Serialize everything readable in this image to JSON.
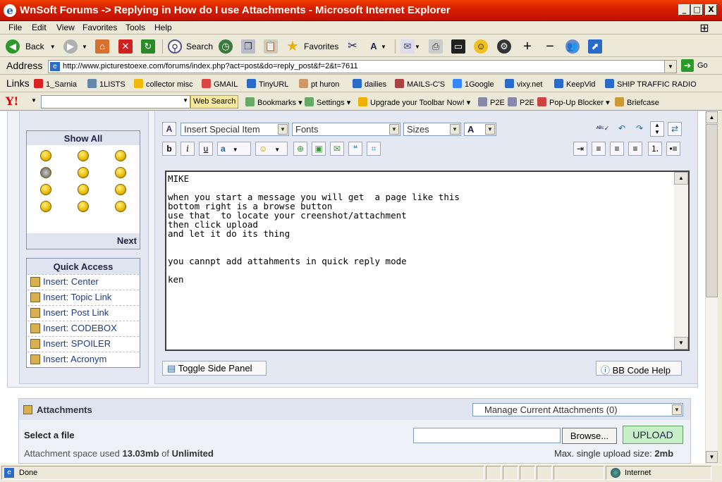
{
  "window": {
    "title": "WnSoft Forums -> Replying in How do I use Attachments - Microsoft Internet Explorer",
    "min": "_",
    "max": "□",
    "close": "X"
  },
  "menu": [
    "File",
    "Edit",
    "View",
    "Favorites",
    "Tools",
    "Help"
  ],
  "toolbar": {
    "back": "Back",
    "search": "Search",
    "favorites": "Favorites"
  },
  "address": {
    "label": "Address",
    "url": "http://www.picturestoexe.com/forums/index.php?act=post&do=reply_post&f=2&t=7611",
    "go": "Go"
  },
  "links": {
    "label": "Links",
    "items": [
      "1_Sarnia",
      "1LISTS",
      "collector misc",
      "GMAIL",
      "TinyURL",
      "pt huron",
      "dailies",
      "MAILS-C'S",
      "1Google",
      "vixy.net",
      "KeepVid",
      "SHIP TRAFFIC RADIO"
    ]
  },
  "yahoo": {
    "logo": "Y!",
    "search_btn": "Web Search",
    "bookmarks": "Bookmarks",
    "settings": "Settings",
    "upgrade": "Upgrade your Toolbar Now!",
    "p2e1": "P2E",
    "p2e2": "P2E",
    "popup": "Pop-Up Blocker",
    "briefcase": "Briefcase"
  },
  "side": {
    "show_all": "Show All",
    "next": "Next",
    "quick_access": "Quick Access",
    "items": [
      "Insert: Center",
      "Insert: Topic Link",
      "Insert: Post Link",
      "Insert: CODEBOX",
      "Insert: SPOILER",
      "Insert: Acronym"
    ]
  },
  "editor": {
    "special": "Insert Special Item",
    "fonts": "Fonts",
    "sizes": "Sizes",
    "color": "A",
    "bold": "b",
    "italic": "i",
    "underline": "u",
    "text": "MIKE\n\nwhen you start a message you will get  a page like this\nbottom right is a browse button\nuse that  to locate your creenshot/attachment\nthen click upload\nand let it do its thing\n\n\nyou cannpt add attahments in quick reply mode\n\nken",
    "toggle": "Toggle Side Panel",
    "bbhelp": "BB Code Help"
  },
  "attachments": {
    "title": "Attachments",
    "manage": "Manage Current Attachments (0)",
    "select": "Select a file",
    "browse": "Browse...",
    "upload": "UPLOAD",
    "space_pre": "Attachment space used ",
    "space_used": "13.03mb",
    "space_mid": " of ",
    "space_total": "Unlimited",
    "max_label": "Max. single upload size: ",
    "max_val": "2mb"
  },
  "status": {
    "done": "Done",
    "zone": "Internet"
  }
}
